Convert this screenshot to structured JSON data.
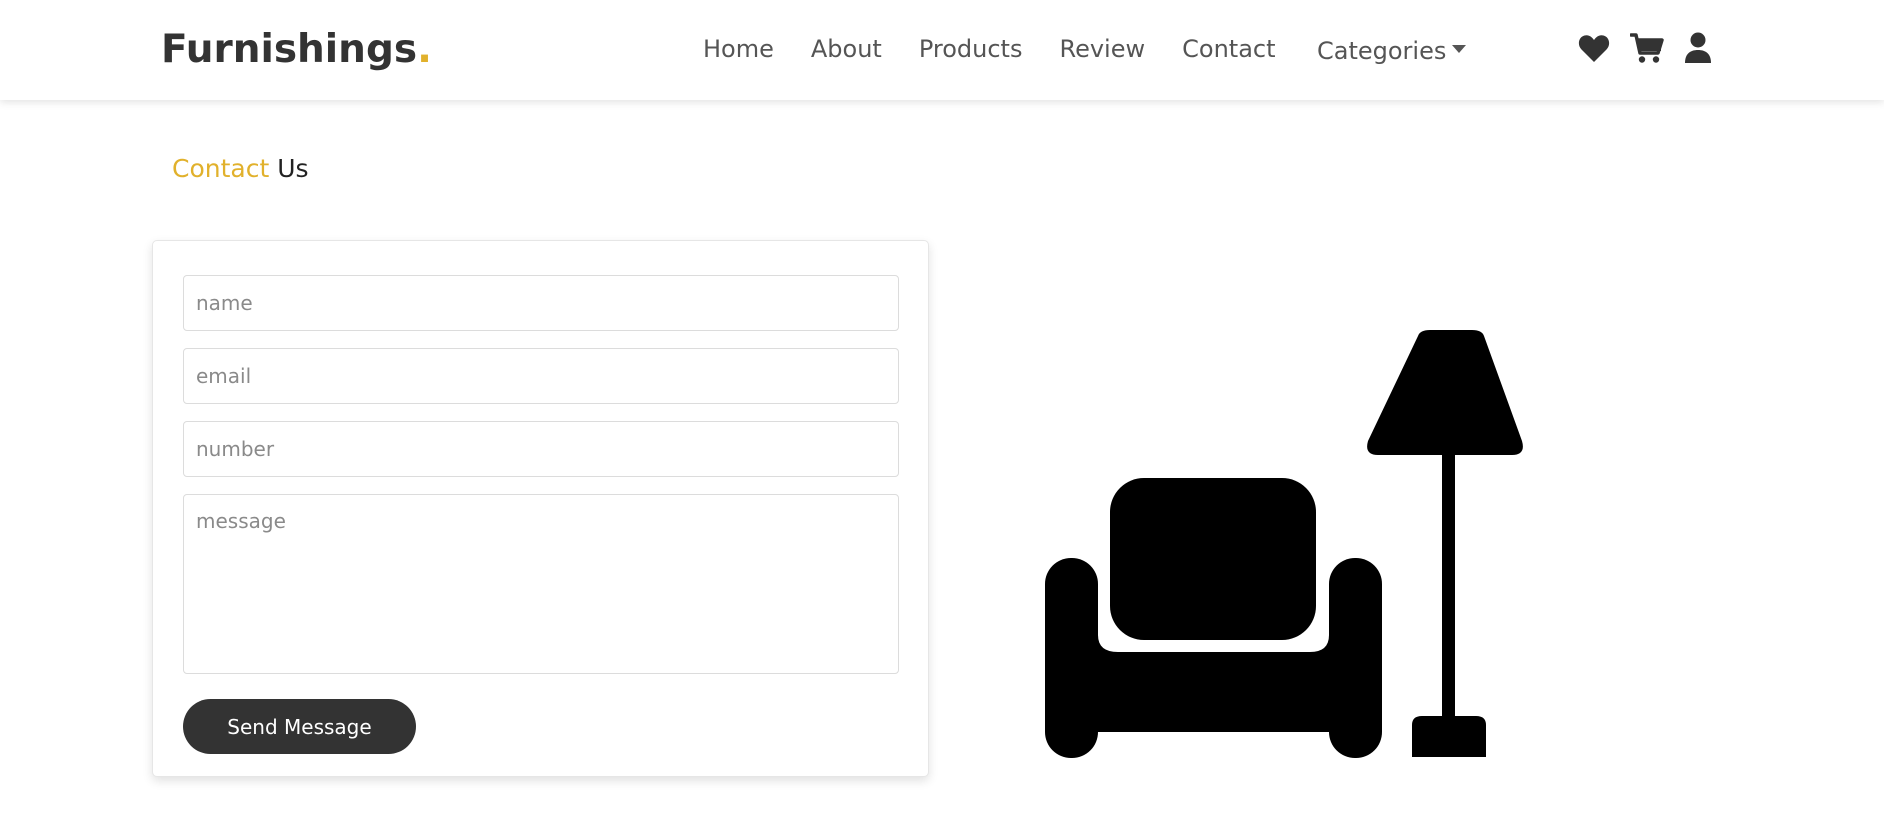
{
  "header": {
    "logo_text": "Furnishings",
    "logo_dot": ".",
    "nav": {
      "home": "Home",
      "about": "About",
      "products": "Products",
      "review": "Review",
      "contact": "Contact",
      "categories": "Categories"
    },
    "icons": [
      "heart-icon",
      "cart-icon",
      "user-icon"
    ]
  },
  "section": {
    "title_accent": "Contact",
    "title_rest": "Us"
  },
  "form": {
    "name_placeholder": "name",
    "email_placeholder": "email",
    "number_placeholder": "number",
    "message_placeholder": "message",
    "send_label": "Send Message"
  },
  "illustration": {
    "icon": "armchair-lamp-icon"
  },
  "colors": {
    "accent": "#e1b12c",
    "dark": "#333333",
    "text": "#555555"
  }
}
